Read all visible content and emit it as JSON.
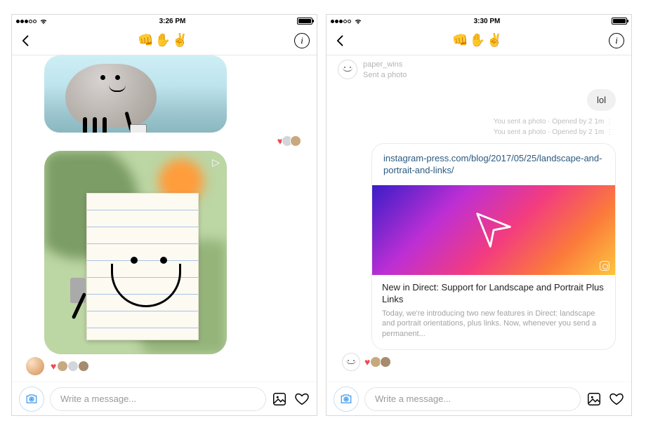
{
  "left": {
    "status": {
      "time": "3:26 PM"
    },
    "header": {
      "title": "👊✋✌️"
    },
    "composer": {
      "placeholder": "Write a message..."
    }
  },
  "right": {
    "status": {
      "time": "3:30 PM"
    },
    "header": {
      "title": "👊✋✌️"
    },
    "incoming": {
      "username": "paper_wins",
      "subtitle": "Sent a photo"
    },
    "reply": {
      "text": "lol"
    },
    "meta": {
      "line1": "You sent a photo · Opened by 2 1m",
      "line2": "You sent a photo · Opened by 2 1m"
    },
    "link": {
      "url": "instagram-press.com/blog/2017/05/25/landscape-and-portrait-and-links/",
      "title": "New in Direct: Support for Landscape and Portrait Plus Links",
      "description": "Today, we're introducing two new features in Direct: landscape and portrait orientations, plus links. Now, whenever you send a permanent..."
    },
    "composer": {
      "placeholder": "Write a message..."
    }
  }
}
